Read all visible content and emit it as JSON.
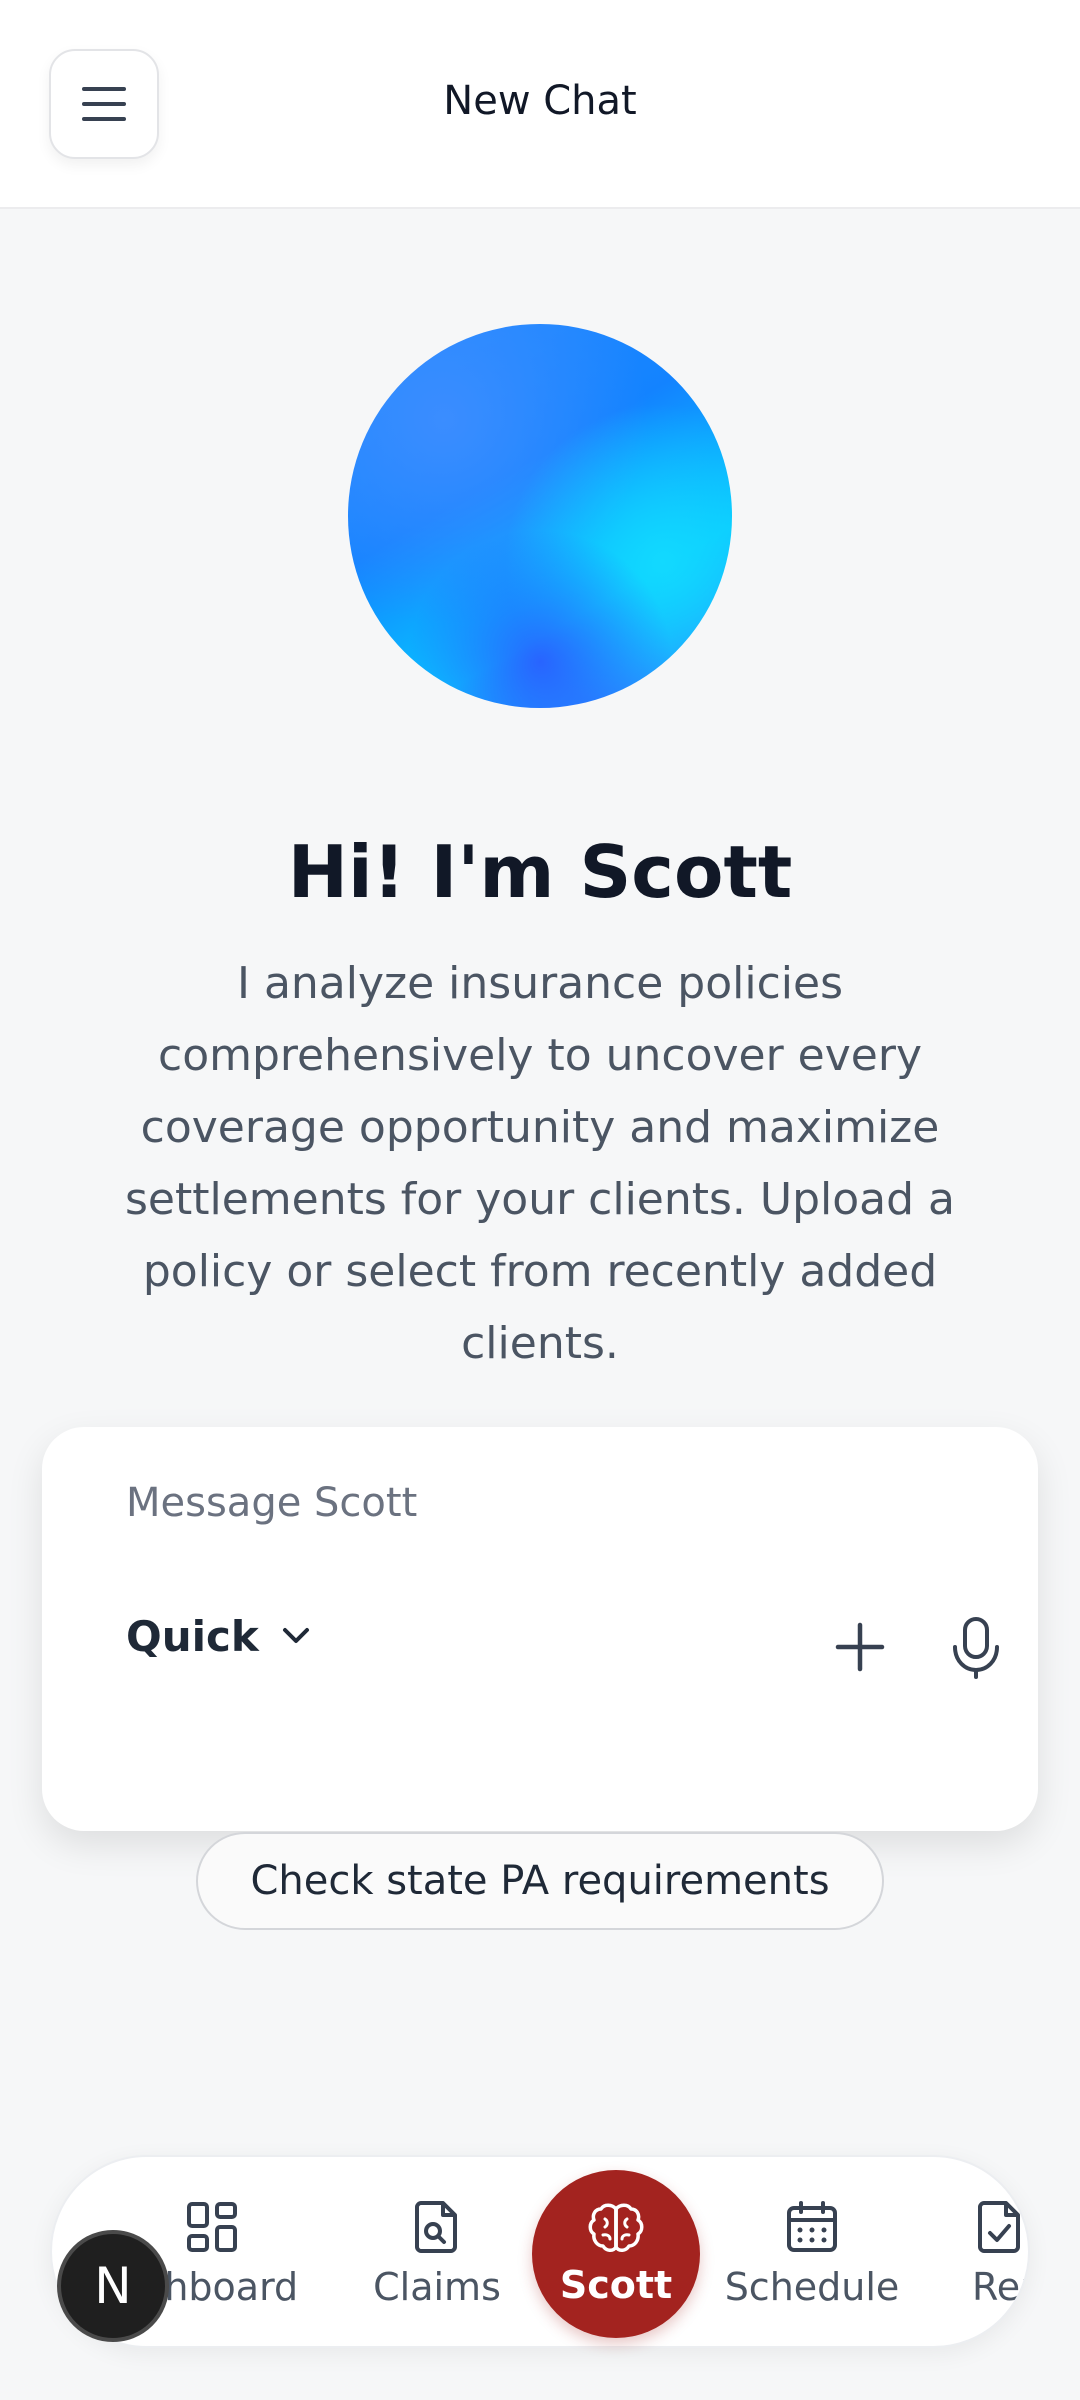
{
  "header": {
    "title": "New Chat",
    "menu_icon": "hamburger-menu-icon"
  },
  "hero": {
    "avatar": "scott-gradient-orb",
    "greeting": "Hi! I'm Scott",
    "description": "I analyze insurance policies comprehensively to uncover every coverage opportunity and maximize settlements for your clients. Upload a policy or select from recently added clients."
  },
  "composer": {
    "placeholder": "Message Scott",
    "value": "",
    "mode_label": "Quick",
    "mode_icon": "chevron-down-icon",
    "add_icon": "plus-icon",
    "mic_icon": "microphone-icon"
  },
  "suggestions": [
    {
      "label": "Check state PA requirements"
    }
  ],
  "bottom_nav": {
    "items": [
      {
        "label": "Dashboard",
        "icon": "dashboard-grid-icon"
      },
      {
        "label": "Claims",
        "icon": "document-search-icon"
      },
      {
        "label": "Scott",
        "icon": "brain-icon",
        "active": true
      },
      {
        "label": "Schedule",
        "icon": "calendar-icon"
      },
      {
        "label": "Reports",
        "icon": "document-check-icon"
      }
    ]
  },
  "user_badge": {
    "initial": "N"
  },
  "colors": {
    "accent": "#a3231f",
    "orb_primary": "#1383ff",
    "orb_secondary": "#08c6ff",
    "text_primary": "#111827",
    "text_secondary": "#4b5563"
  }
}
